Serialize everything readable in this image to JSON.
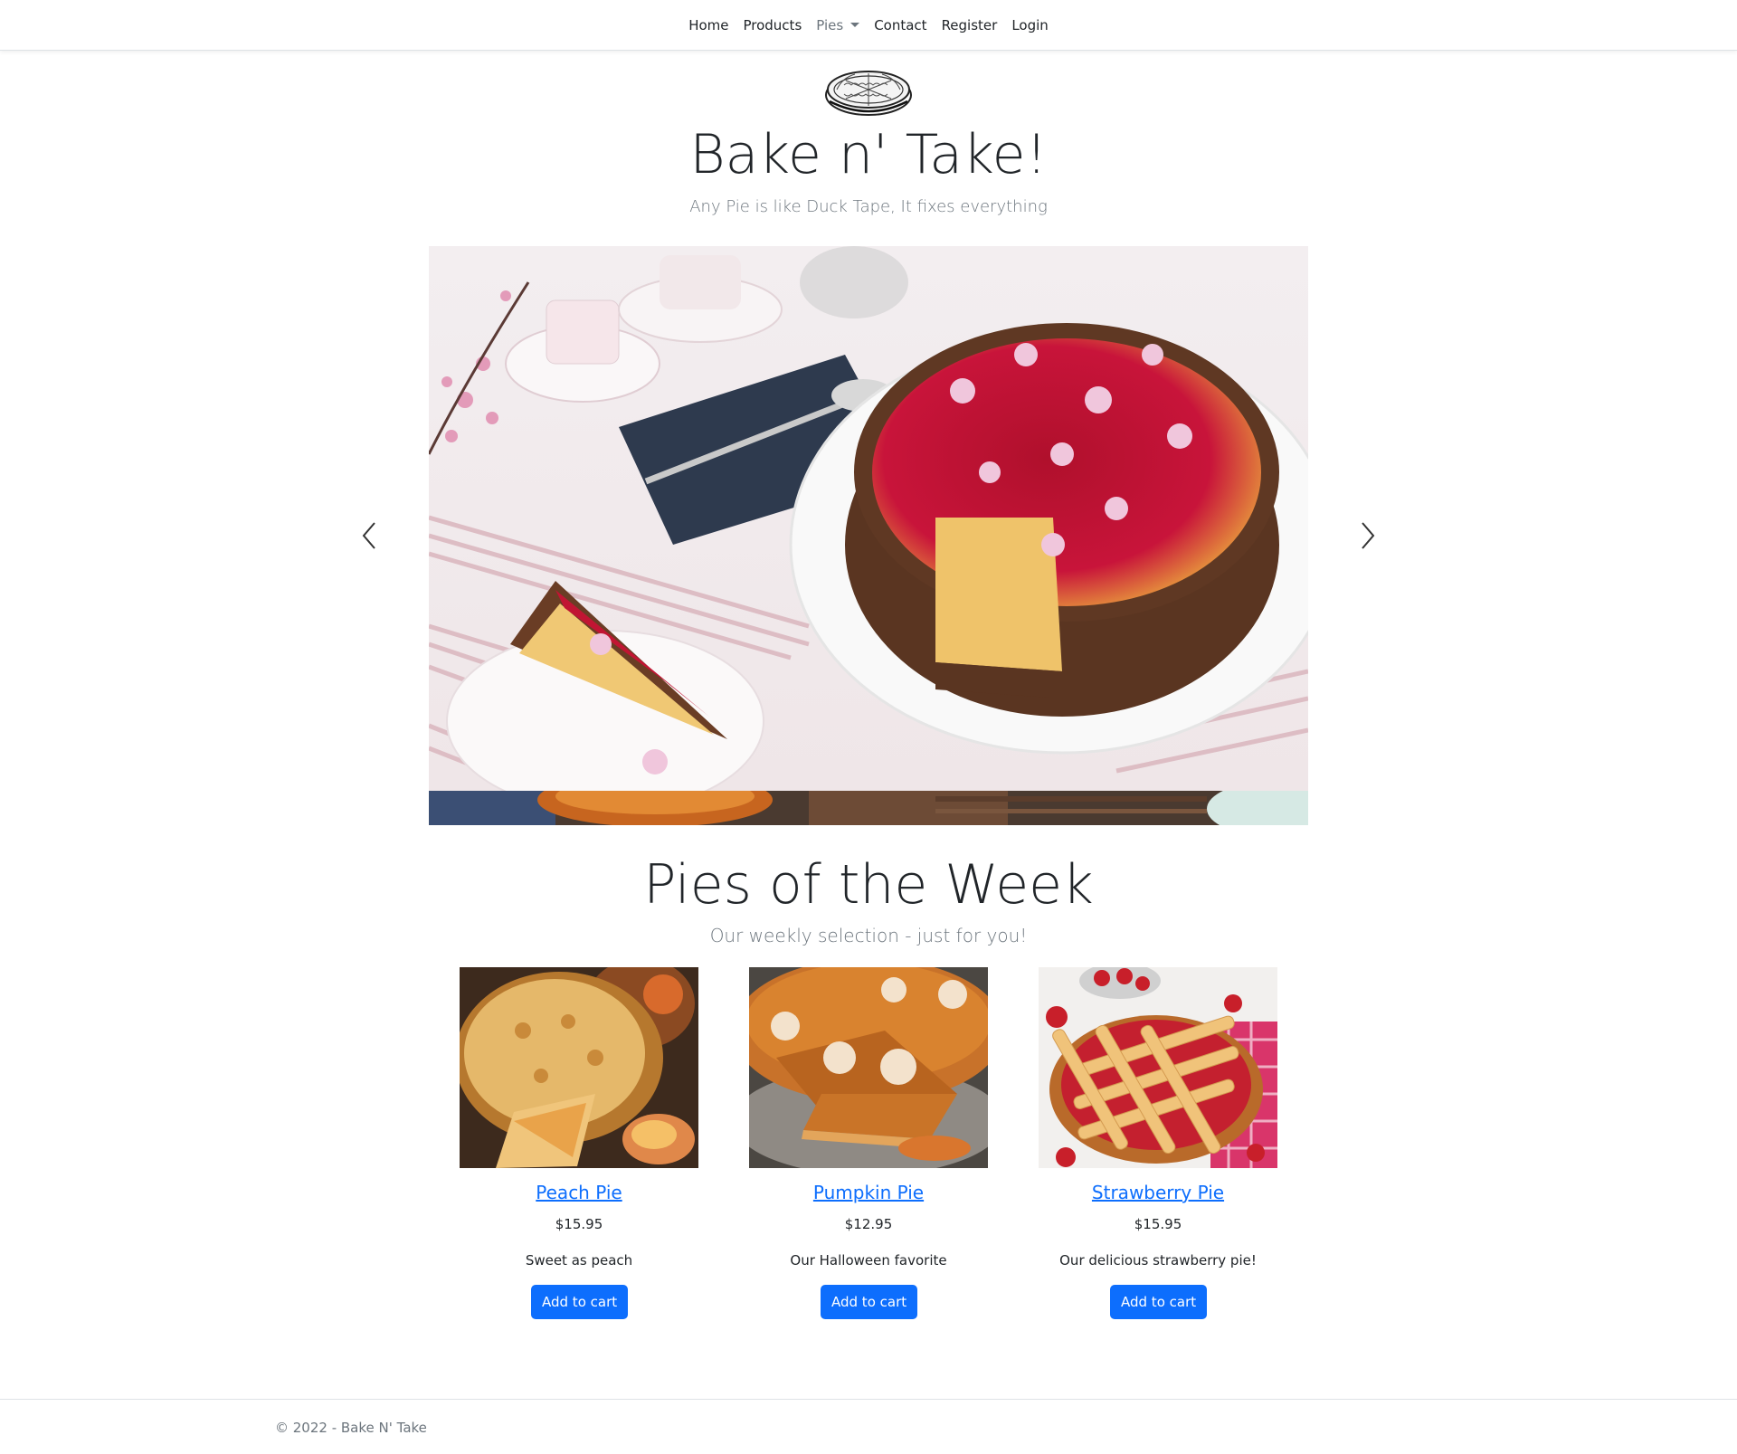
{
  "nav": {
    "items": [
      {
        "label": "Home"
      },
      {
        "label": "Products"
      },
      {
        "label": "Pies"
      },
      {
        "label": "Contact"
      },
      {
        "label": "Register"
      },
      {
        "label": "Login"
      }
    ]
  },
  "header": {
    "title": "Bake n' Take!",
    "tagline": "Any Pie is like Duck Tape, It fixes everything"
  },
  "carousel": {
    "prev_icon": "chevron-left-icon",
    "next_icon": "chevron-right-icon"
  },
  "pies_section": {
    "title": "Pies of the Week",
    "subtitle": "Our weekly selection - just for you!",
    "cards": [
      {
        "name": "Peach Pie",
        "price": "$15.95",
        "description": "Sweet as peach",
        "button": "Add to cart"
      },
      {
        "name": "Pumpkin Pie",
        "price": "$12.95",
        "description": "Our Halloween favorite",
        "button": "Add to cart"
      },
      {
        "name": "Strawberry Pie",
        "price": "$15.95",
        "description": "Our delicious strawberry pie!",
        "button": "Add to cart"
      }
    ]
  },
  "footer": {
    "text": "© 2022 - Bake N' Take"
  },
  "colors": {
    "link": "#0d6efd",
    "button": "#0d6efd",
    "muted": "#6c757d"
  }
}
